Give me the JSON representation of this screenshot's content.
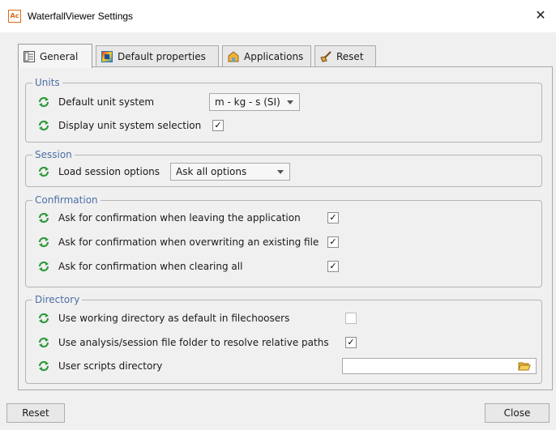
{
  "window": {
    "title": "WaterfallViewer Settings",
    "app_icon_text": "Ac",
    "close_glyph": "✕"
  },
  "tabs": [
    {
      "label": "General",
      "icon": "general-icon",
      "active": true
    },
    {
      "label": "Default properties",
      "icon": "color-gradient-icon",
      "active": false
    },
    {
      "label": "Applications",
      "icon": "applications-icon",
      "active": false
    },
    {
      "label": "Reset",
      "icon": "broom-icon",
      "active": false
    }
  ],
  "groups": {
    "units": {
      "title": "Units",
      "default_unit_label": "Default unit system",
      "default_unit_value": "m - kg - s (SI)",
      "display_selection_label": "Display unit system selection",
      "display_selection_checked": true
    },
    "session": {
      "title": "Session",
      "load_options_label": "Load session options",
      "load_options_value": "Ask all options"
    },
    "confirmation": {
      "title": "Confirmation",
      "items": [
        {
          "label": "Ask for confirmation when leaving the application",
          "checked": true
        },
        {
          "label": "Ask for confirmation when overwriting an existing file",
          "checked": true
        },
        {
          "label": "Ask for confirmation when clearing all",
          "checked": true
        }
      ]
    },
    "directory": {
      "title": "Directory",
      "working_dir_label": "Use working directory as default in filechoosers",
      "working_dir_checked": false,
      "analysis_folder_label": "Use analysis/session file folder to resolve relative paths",
      "analysis_folder_checked": true,
      "scripts_dir_label": "User scripts directory",
      "scripts_dir_value": ""
    }
  },
  "buttons": {
    "reset": "Reset",
    "close": "Close"
  },
  "colors": {
    "group_title": "#4a6fa5",
    "refresh_icon": "#2e9a3a",
    "check": "#000000"
  }
}
